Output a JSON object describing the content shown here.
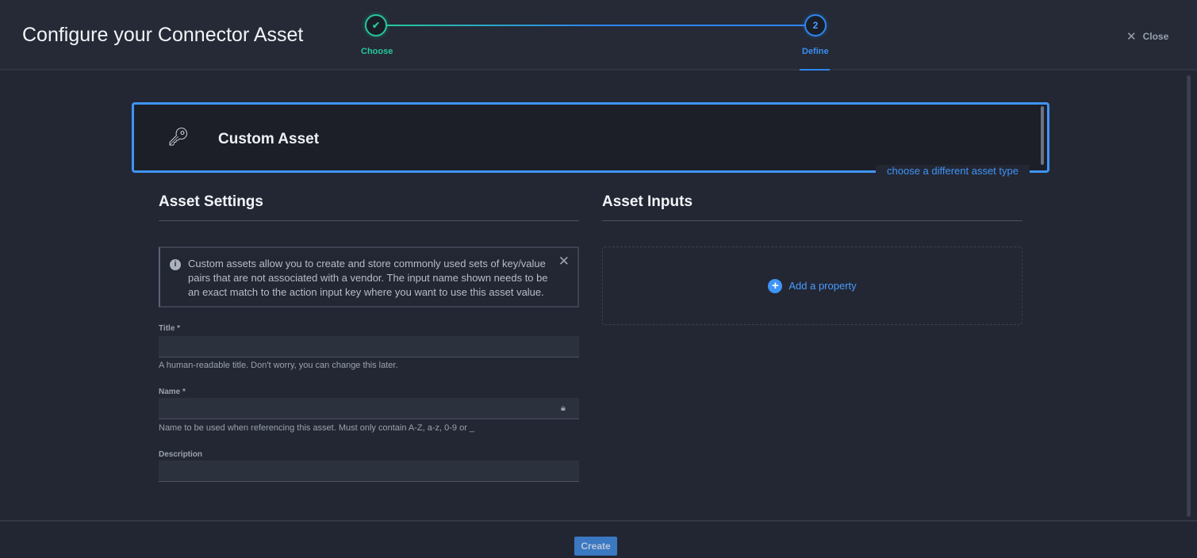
{
  "header": {
    "title": "Configure your Connector Asset",
    "close_label": "Close",
    "steps": [
      {
        "label": "Choose",
        "state": "complete",
        "icon": "check-icon"
      },
      {
        "label": "Define",
        "number": "2",
        "state": "active"
      }
    ]
  },
  "asset_card": {
    "icon": "key-icon",
    "name": "Custom Asset",
    "change_link": "choose a different asset type"
  },
  "settings": {
    "heading": "Asset Settings",
    "info": "Custom assets allow you to create and store commonly used sets of key/value pairs that are not associated with a vendor. The input name shown needs to be an exact match to the action input key where you want to use this asset value.",
    "title_label": "Title *",
    "title_value": "",
    "title_help": "A human-readable title. Don't worry, you can change this later.",
    "name_label": "Name *",
    "name_value": "",
    "name_help": "Name to be used when referencing this asset. Must only contain A-Z, a-z, 0-9 or _",
    "description_label": "Description",
    "description_value": ""
  },
  "inputs": {
    "heading": "Asset Inputs",
    "add_label": "Add a property"
  },
  "footer": {
    "create_label": "Create"
  },
  "colors": {
    "accent": "#3f94f7",
    "success": "#27c79a",
    "background": "#232733"
  }
}
